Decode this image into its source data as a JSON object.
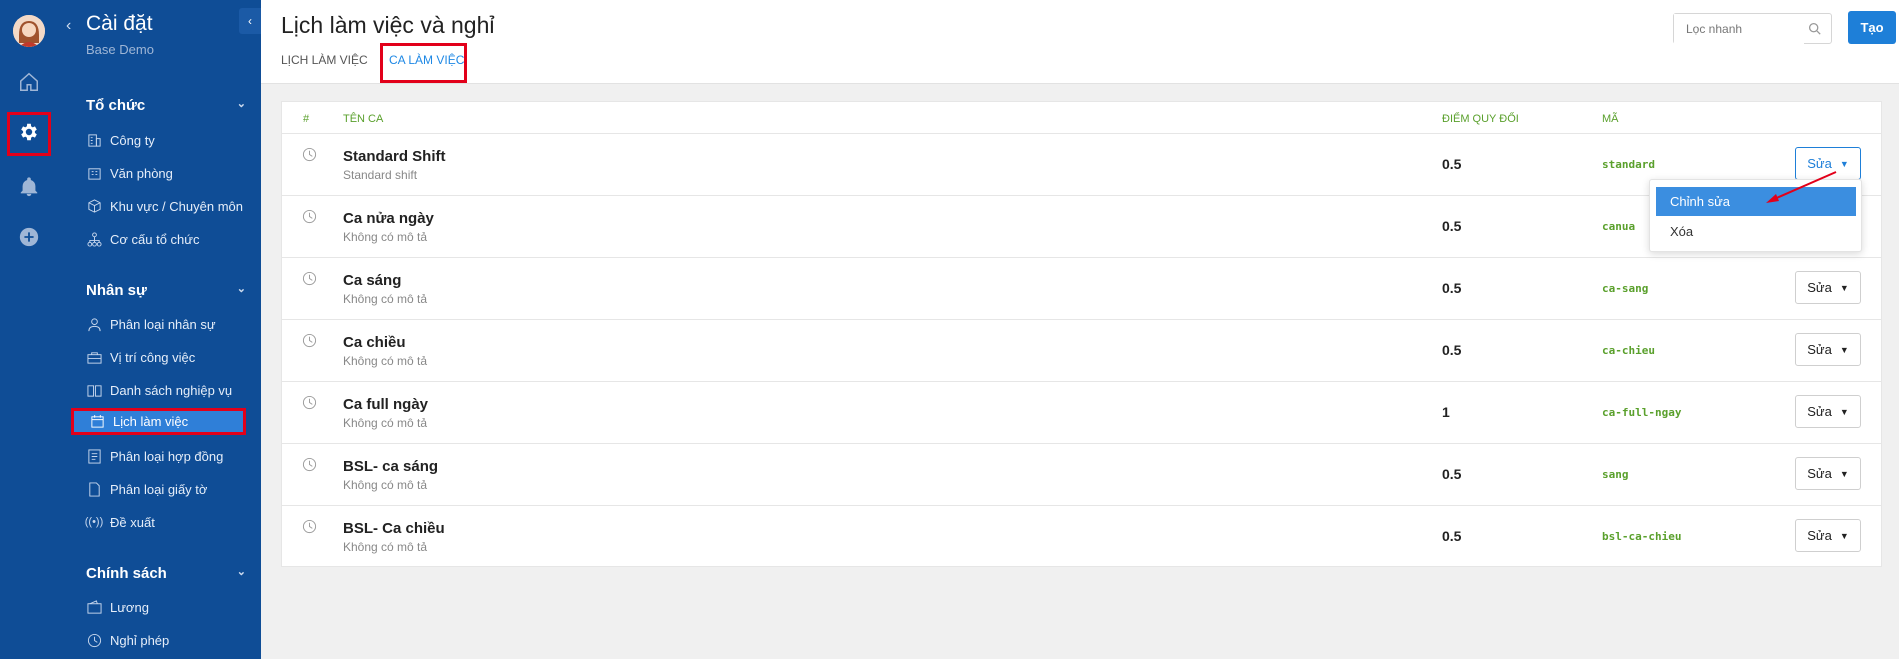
{
  "sidebar": {
    "title": "Cài đặt",
    "subtitle": "Base Demo",
    "sections": [
      {
        "label": "Tổ chức"
      },
      {
        "label": "Nhân sự"
      },
      {
        "label": "Chính sách"
      }
    ],
    "items": [
      {
        "label": "Công ty"
      },
      {
        "label": "Văn phòng"
      },
      {
        "label": "Khu vực / Chuyên môn"
      },
      {
        "label": "Cơ cấu tổ chức"
      },
      {
        "label": "Phân loại nhân sự"
      },
      {
        "label": "Vị trí công việc"
      },
      {
        "label": "Danh sách nghiệp vụ"
      },
      {
        "label": "Lịch làm việc"
      },
      {
        "label": "Phân loại hợp đồng"
      },
      {
        "label": "Phân loại giấy tờ"
      },
      {
        "label": "Đề xuất"
      },
      {
        "label": "Lương"
      },
      {
        "label": "Nghỉ phép"
      }
    ]
  },
  "header": {
    "title": "Lịch làm việc và nghỉ",
    "tabs": [
      {
        "label": "LỊCH LÀM VIỆC"
      },
      {
        "label": "CA LÀM VIỆC"
      }
    ],
    "search_placeholder": "Lọc nhanh",
    "create_label": "Tạo"
  },
  "table": {
    "columns": [
      "#",
      "TÊN CA",
      "ĐIỂM QUY ĐỔI",
      "MÃ"
    ],
    "rows": [
      {
        "name": "Standard Shift",
        "desc": "Standard shift",
        "points": "0.5",
        "code": "standard",
        "action": "Sửa"
      },
      {
        "name": "Ca nửa ngày",
        "desc": "Không có mô tả",
        "points": "0.5",
        "code": "canua",
        "action": "Sửa"
      },
      {
        "name": "Ca sáng",
        "desc": "Không có mô tả",
        "points": "0.5",
        "code": "ca-sang",
        "action": "Sửa"
      },
      {
        "name": "Ca chiều",
        "desc": "Không có mô tả",
        "points": "0.5",
        "code": "ca-chieu",
        "action": "Sửa"
      },
      {
        "name": "Ca full ngày",
        "desc": "Không có mô tả",
        "points": "1",
        "code": "ca-full-ngay",
        "action": "Sửa"
      },
      {
        "name": "BSL- ca sáng",
        "desc": "Không có mô tả",
        "points": "0.5",
        "code": "sang",
        "action": "Sửa"
      },
      {
        "name": "BSL- Ca chiều",
        "desc": "Không có mô tả",
        "points": "0.5",
        "code": "bsl-ca-chieu",
        "action": "Sửa"
      }
    ]
  },
  "dropdown": {
    "items": [
      {
        "label": "Chỉnh sửa"
      },
      {
        "label": "Xóa"
      }
    ]
  },
  "colors": {
    "sidebar_bg": "#0f4d96",
    "accent": "#1e7fd8",
    "highlight": "#e2001a",
    "code_green": "#5aa02c"
  }
}
